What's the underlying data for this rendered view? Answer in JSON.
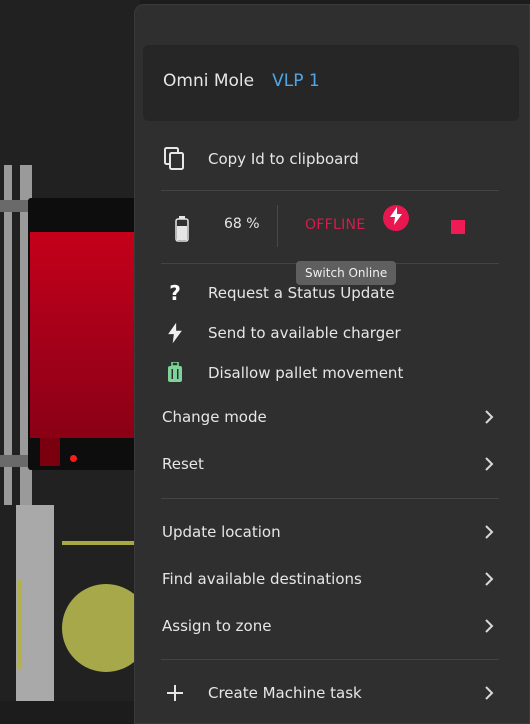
{
  "menu": {
    "title_name": "Omni Mole",
    "title_id": "VLP 1",
    "copy_id_label": "Copy Id to clipboard",
    "battery": "68 %",
    "status_text": "OFFLINE",
    "tooltip": "Switch Online",
    "actions": [
      {
        "label": "Request a Status Update",
        "icon": "question-icon"
      },
      {
        "label": "Send to available charger",
        "icon": "lightning-icon"
      },
      {
        "label": "Disallow pallet movement",
        "icon": "luggage-icon"
      }
    ],
    "submenus_1": [
      "Change mode",
      "Reset"
    ],
    "submenus_2": [
      "Update location",
      "Find available destinations",
      "Assign to zone"
    ],
    "create_task_label": "Create Machine task",
    "colors": {
      "accent": "#4fa7e8",
      "danger": "#e8174f",
      "green": "#7ed39a"
    }
  }
}
